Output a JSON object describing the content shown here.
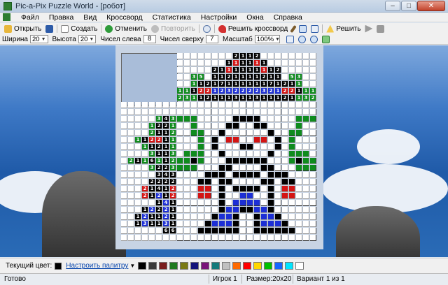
{
  "window": {
    "title": "Pic-a-Pix Puzzle World - [робот]"
  },
  "menu": [
    "Файл",
    "Правка",
    "Вид",
    "Кроссворд",
    "Статистика",
    "Настройки",
    "Окна",
    "Справка"
  ],
  "toolbar1": {
    "open": "Открыть",
    "create": "Создать",
    "undo": "Отменить",
    "redo": "Повторить",
    "solve_crossword": "Решить кроссворд",
    "solve": "Решить"
  },
  "toolbar2": {
    "width_label": "Ширина",
    "width_value": "20",
    "height_label": "Высота",
    "height_value": "20",
    "left_numbers_label": "Чисел слева",
    "left_numbers_value": "8",
    "top_numbers_label": "Чисел сверху",
    "top_numbers_value": "7",
    "zoom_label": "Масштаб",
    "zoom_value": "100%"
  },
  "palette": {
    "current_label": "Текущий цвет:",
    "current_color": "#000000",
    "link": "Настроить палитру",
    "colors": [
      "#000000",
      "#3a3a3a",
      "#7a1c1c",
      "#1f7a1f",
      "#7a7a14",
      "#14147a",
      "#7a147a",
      "#147a7a",
      "#c0c0c0",
      "#ff6a00",
      "#ff0000",
      "#ffd700",
      "#00c000",
      "#1565ff",
      "#00e5ff",
      "#ffffff"
    ]
  },
  "status": {
    "ready": "Готово",
    "player": "Игрок 1",
    "size": "Размер:20x20",
    "variant": "Вариант 1 из 1"
  },
  "colors": {
    "green": "#0f8c1e",
    "red": "#d41414",
    "blue": "#1c2fd6",
    "black": "#000000",
    "white": "#ffffff"
  },
  "puzzle": {
    "top_clues": [
      "..................................................................................",
      "..................................................................................",
      "........................k1...k1...k1.....................................................",
      "........................................................................................",
      "........................................................................................",
      "........................................................................................",
      "........................................................................................"
    ],
    "left_clues": [
      "k3.k1.g1.g1.g1.k3..",
      "..k3.k1.k1.k1.k3..",
      "..k3.k1.k1.k1.k3.."
    ]
  }
}
